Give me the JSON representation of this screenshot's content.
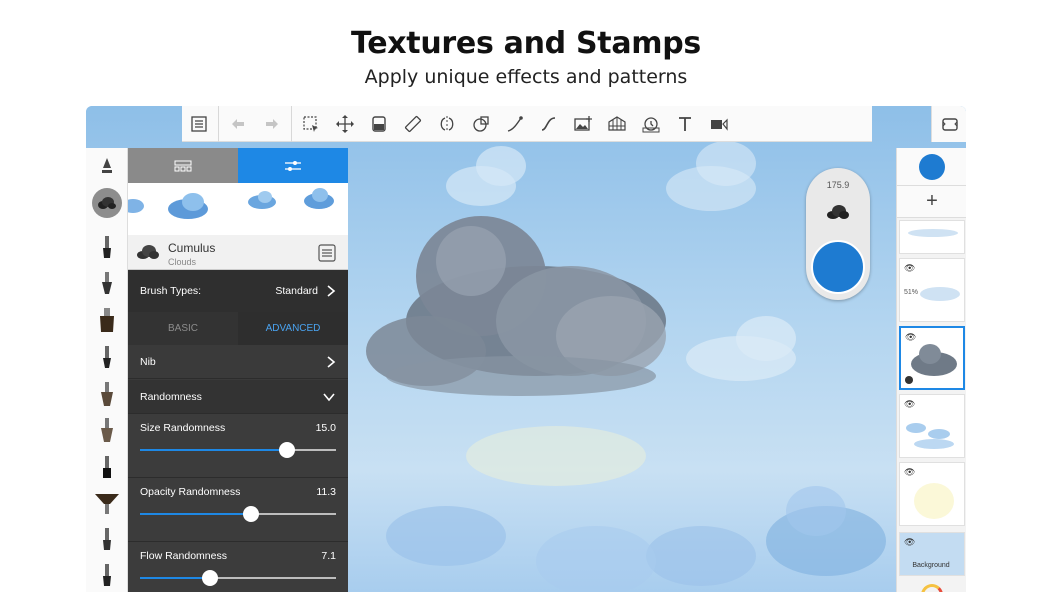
{
  "header": {
    "title": "Textures and Stamps",
    "subtitle": "Apply unique effects and patterns"
  },
  "toolbar": {
    "icons": [
      "list-icon",
      "undo-icon",
      "redo-icon",
      "selection-icon",
      "transform-icon",
      "fill-icon",
      "ruler-icon",
      "symmetry-icon",
      "shapes-icon",
      "curve-icon",
      "stroke-icon",
      "image-icon",
      "perspective-icon",
      "timelapse-icon",
      "text-icon",
      "video-icon",
      "fullscreen-icon"
    ]
  },
  "brush": {
    "name": "Cumulus",
    "category": "Clouds",
    "type_label": "Brush Types:",
    "type_value": "Standard",
    "tab_basic": "BASIC",
    "tab_advanced": "ADVANCED",
    "nib_label": "Nib",
    "randomness_label": "Randomness",
    "sliders": [
      {
        "label": "Size Randomness",
        "value": "15.0",
        "fraction": 0.75
      },
      {
        "label": "Opacity Randomness",
        "value": "11.3",
        "fraction": 0.565
      },
      {
        "label": "Flow Randomness",
        "value": "7.1",
        "fraction": 0.355
      }
    ]
  },
  "size_indicator": {
    "value": "175.9"
  },
  "layers": {
    "add_label": "+",
    "opacity_label": "51%",
    "background_label": "Background",
    "eye_glyph": "👁"
  },
  "colors": {
    "accent": "#1e88e5",
    "current_color": "#1e7bd1",
    "panel_bg": "#3a3a3a"
  }
}
